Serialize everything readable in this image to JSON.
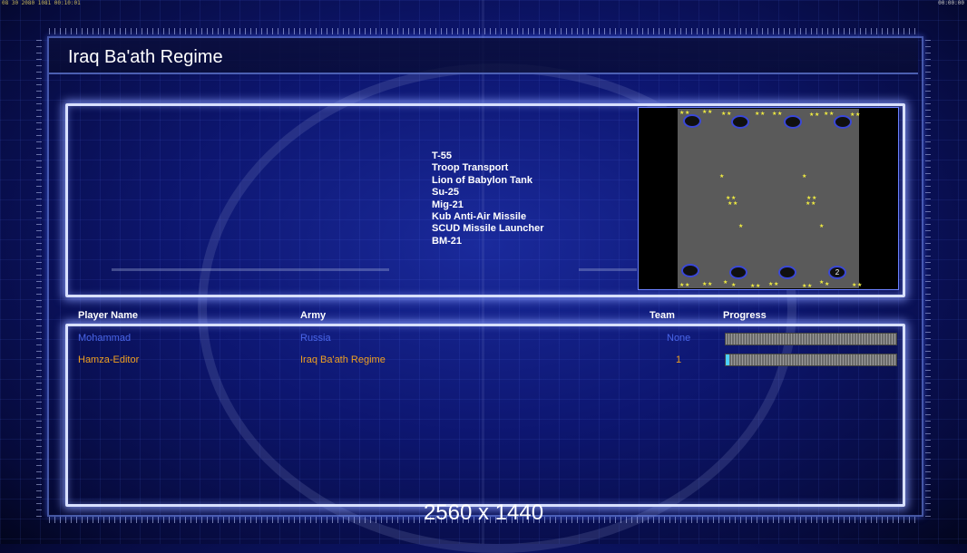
{
  "topbar": {
    "left_clock": "08 30 2080 1081 00:10:01",
    "right_clock": "00:00:00"
  },
  "screen": {
    "title": "Iraq Ba'ath Regime",
    "resolution_label": "2560 x 1440"
  },
  "units": [
    "T-55",
    "Troop Transport",
    "Lion of Babylon Tank",
    "Su-25",
    "Mig-21",
    "Kub Anti-Air Missile",
    "SCUD Missile Launcher",
    "BM-21"
  ],
  "minimap": {
    "occupied_slot_label": "2",
    "star_icon": "yellow-star"
  },
  "table": {
    "headers": {
      "player_name": "Player Name",
      "army": "Army",
      "team": "Team",
      "progress": "Progress"
    },
    "rows": [
      {
        "player_name": "Mohammad",
        "army": "Russia",
        "team": "None",
        "progress": 0.0,
        "color": "#4a66e8"
      },
      {
        "player_name": "Hamza-Editor",
        "army": "Iraq Ba'ath Regime",
        "team": "1",
        "progress": 0.02,
        "color": "#f0a020"
      }
    ]
  },
  "colors": {
    "progress_fill": "#4cd0ff",
    "panel_glow": "#d8e0ff",
    "star": "#f2ee40"
  }
}
